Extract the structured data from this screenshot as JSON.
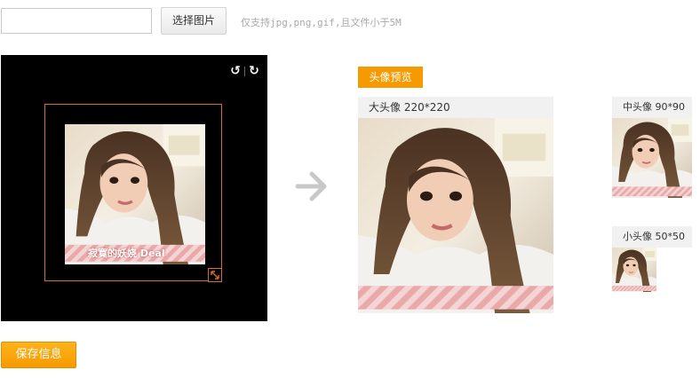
{
  "upload": {
    "file_value": "",
    "choose_label": "选择图片",
    "hint": "仅支持jpg,png,gif,且文件小于5M"
  },
  "editor": {
    "rotate_left_icon": "rotate-left-icon",
    "rotate_right_icon": "rotate-right-icon",
    "resize_icon": "resize-handle-icon",
    "photo_watermark": "寂寞的妖娆 Deal"
  },
  "preview": {
    "title": "头像预览",
    "big_label": "大头像 220*220",
    "medium_label": "中头像 90*90",
    "small_label": "小头像 50*50",
    "arrow_icon": "arrow-right-icon"
  },
  "actions": {
    "save_label": "保存信息"
  },
  "colors": {
    "accent": "#f59a00",
    "crop_border": "#d6711f",
    "editor_bg": "#000000"
  }
}
